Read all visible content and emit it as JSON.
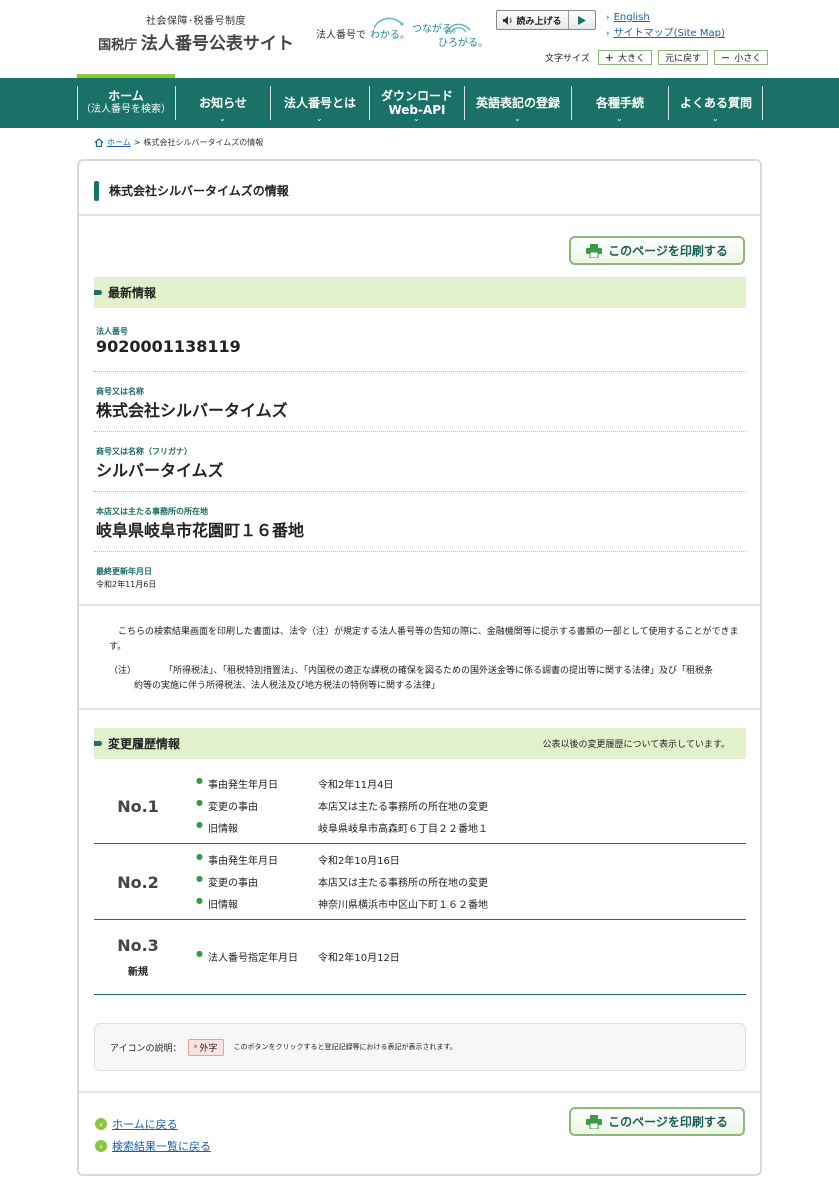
{
  "header": {
    "logo_sub": "社会保障･税番号制度",
    "logo_org": "国税庁",
    "logo_title": "法人番号公表サイト",
    "tagline_lead": "法人番号で",
    "tagline_w1": "わかる。",
    "tagline_w2": "つながる。",
    "tagline_w3": "ひろがる。",
    "read_aloud": "読み上げる",
    "english": "English",
    "sitemap": "サイトマップ(Site Map)",
    "fontsize_label": "文字サイズ",
    "fontsize_large": "大きく",
    "fontsize_reset": "元に戻す",
    "fontsize_small": "小さく"
  },
  "nav": {
    "home": "ホーム",
    "home_sub": "（法人番号を検索）",
    "news": "お知らせ",
    "about": "法人番号とは",
    "download": "ダウンロード",
    "download_sub": "Web-API",
    "english_reg": "英語表記の登録",
    "procedures": "各種手続",
    "faq": "よくある質問"
  },
  "breadcrumb": {
    "home": "ホーム",
    "sep": ">",
    "current": "株式会社シルバータイムズの情報"
  },
  "page": {
    "title": "株式会社シルバータイムズの情報",
    "print": "このページを印刷する"
  },
  "latest": {
    "heading": "最新情報",
    "corp_no_label": "法人番号",
    "corp_no": "9020001138119",
    "name_label": "商号又は名称",
    "name": "株式会社シルバータイムズ",
    "kana_label": "商号又は名称（フリガナ）",
    "kana": "シルバータイムズ",
    "address_label": "本店又は主たる事務所の所在地",
    "address": "岐阜県岐阜市花園町１６番地",
    "updated_label": "最終更新年月日",
    "updated": "令和2年11月6日"
  },
  "notice": {
    "body": "こちらの検索結果画面を印刷した書面は、法令（注）が規定する法人番号等の告知の際に、金融機関等に提示する書類の一部として使用することができます。",
    "note_mark": "（注）",
    "note_line1": "「所得税法」、「租税特別措置法」、「内国税の適正な課税の確保を図るための国外送金等に係る調書の提出等に関する法律」及び「租税条",
    "note_line2": "約等の実施に伴う所得税法、法人税法及び地方税法の特例等に関する法律」"
  },
  "history": {
    "heading": "変更履歴情報",
    "note": "公表以後の変更履歴について表示しています。",
    "entries": [
      {
        "no": "No.1",
        "date_label": "事由発生年月日",
        "date": "令和2年11月4日",
        "reason_label": "変更の事由",
        "reason": "本店又は主たる事務所の所在地の変更",
        "old_label": "旧情報",
        "old": "岐阜県岐阜市高森町６丁目２２番地１"
      },
      {
        "no": "No.2",
        "date_label": "事由発生年月日",
        "date": "令和2年10月16日",
        "reason_label": "変更の事由",
        "reason": "本店又は主たる事務所の所在地の変更",
        "old_label": "旧情報",
        "old": "神奈川県横浜市中区山下町１６２番地"
      },
      {
        "no": "No.3",
        "sub": "新規",
        "date_label": "法人番号指定年月日",
        "date": "令和2年10月12日"
      }
    ]
  },
  "legend": {
    "label": "アイコンの説明：",
    "icon_text": "外字",
    "desc": "このボタンをクリックすると登記記録等における表記が表示されます。"
  },
  "footer_links": {
    "home": "ホームに戻る",
    "results": "検索結果一覧に戻る"
  },
  "colors": {
    "brand_green": "#1a7167",
    "accent_light_green": "#e2f1cc",
    "accent_lime": "#8cc63f"
  }
}
